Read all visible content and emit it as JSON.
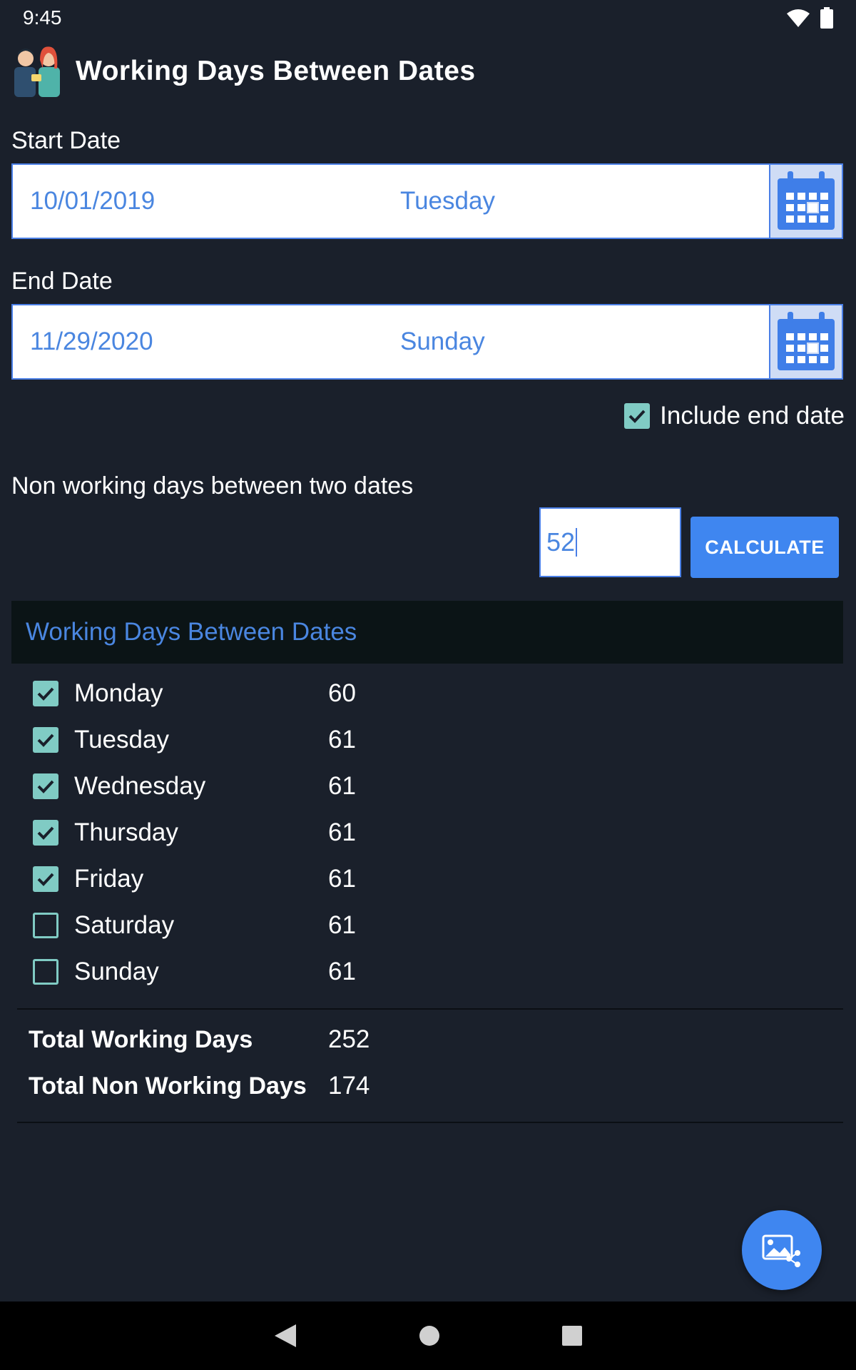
{
  "status_bar": {
    "time": "9:45"
  },
  "app": {
    "title": "Working Days Between Dates"
  },
  "start": {
    "label": "Start Date",
    "date": "10/01/2019",
    "day": "Tuesday"
  },
  "end": {
    "label": "End Date",
    "date": "11/29/2020",
    "day": "Sunday"
  },
  "include_end": {
    "label": "Include end date",
    "checked": true
  },
  "non_working": {
    "label": "Non working days between two dates",
    "value": "52"
  },
  "calculate": {
    "label": "CALCULATE"
  },
  "results": {
    "header": "Working Days Between Dates",
    "days": [
      {
        "name": "Monday",
        "count": "60",
        "checked": true
      },
      {
        "name": "Tuesday",
        "count": "61",
        "checked": true
      },
      {
        "name": "Wednesday",
        "count": "61",
        "checked": true
      },
      {
        "name": "Thursday",
        "count": "61",
        "checked": true
      },
      {
        "name": "Friday",
        "count": "61",
        "checked": true
      },
      {
        "name": "Saturday",
        "count": "61",
        "checked": false
      },
      {
        "name": "Sunday",
        "count": "61",
        "checked": false
      }
    ],
    "total_working_label": "Total Working Days",
    "total_working_value": "252",
    "total_non_working_label": "Total Non Working Days",
    "total_non_working_value": "174"
  },
  "colors": {
    "background": "#1a202b",
    "accent": "#3f86f0",
    "text_blue": "#4a86e0",
    "checkbox": "#80cbc4"
  },
  "icons": {
    "status": [
      "wifi-icon",
      "battery-icon"
    ],
    "logo": "people-logo",
    "calendar": "calendar-icon",
    "fab": "share-image-icon",
    "nav": [
      "back-icon",
      "home-icon",
      "recents-icon"
    ]
  }
}
